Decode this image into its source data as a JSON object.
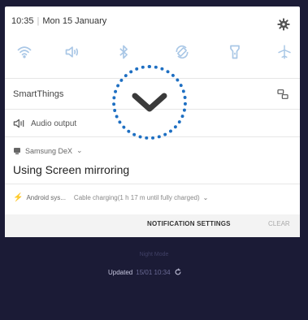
{
  "status_bar": {
    "time": "10:35",
    "date": "Mon 15 January"
  },
  "quick_toggles": [
    "wifi",
    "sound",
    "bluetooth",
    "auto-rotate",
    "flashlight",
    "airplane-mode"
  ],
  "notifications": {
    "smartthings": {
      "label": "SmartThings"
    },
    "audio": {
      "label": "Audio output"
    },
    "dex": {
      "app": "Samsung DeX",
      "title": "Using Screen mirroring"
    },
    "charging": {
      "app": "Android sys...",
      "text": "Cable charging(1 h 17 m until fully charged)"
    }
  },
  "actions": {
    "notification_settings": "NOTIFICATION SETTINGS",
    "clear": "CLEAR"
  },
  "lockscreen": {
    "title": "Night Mode",
    "updated_label": "Updated",
    "updated_time": "15/01 10:34"
  },
  "colors": {
    "accent": "#1e6fc2",
    "toggle_inactive": "#a9c7e6",
    "background": "#1b1b36"
  }
}
